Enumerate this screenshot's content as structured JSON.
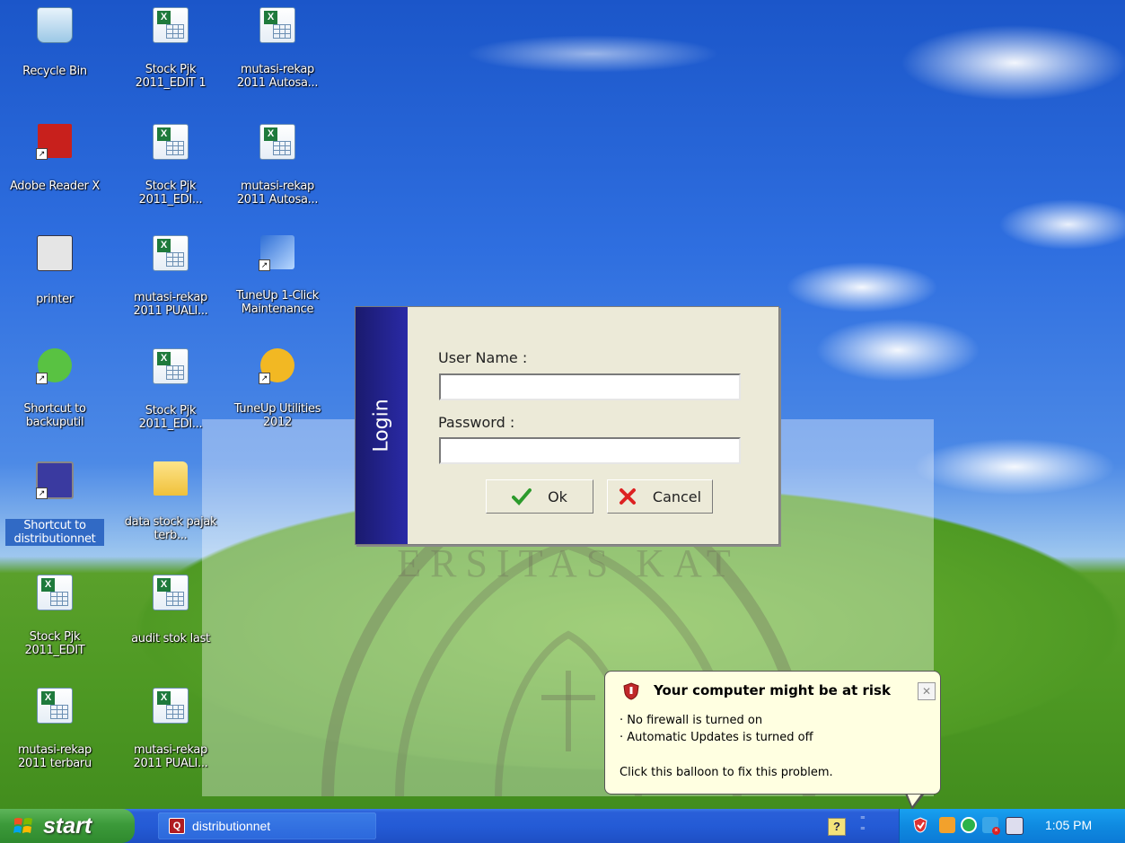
{
  "desktop_icons": [
    {
      "label": "Recycle Bin",
      "icon": "recycle-bin-icon"
    },
    {
      "label": "Stock Pjk 2011_EDIT 1",
      "icon": "excel-file-icon"
    },
    {
      "label": "mutasi-rekap 2011 Autosa...",
      "icon": "excel-file-icon"
    },
    {
      "label": "Adobe Reader X",
      "icon": "adobe-reader-icon"
    },
    {
      "label": "Stock Pjk 2011_EDI...",
      "icon": "excel-file-icon"
    },
    {
      "label": "mutasi-rekap 2011 Autosa...",
      "icon": "excel-file-icon"
    },
    {
      "label": "printer",
      "icon": "printer-app-icon"
    },
    {
      "label": "mutasi-rekap 2011 PUALI...",
      "icon": "excel-file-icon"
    },
    {
      "label": "TuneUp 1-Click Maintenance",
      "icon": "tuneup-maintenance-icon"
    },
    {
      "label": "Shortcut to backuputil",
      "icon": "frog-backup-icon"
    },
    {
      "label": "Stock Pjk 2011_EDI...",
      "icon": "excel-file-icon"
    },
    {
      "label": "TuneUp Utilities 2012",
      "icon": "tuneup-utilities-icon"
    },
    {
      "label": "Shortcut to distributionnet",
      "icon": "distributionnet-icon"
    },
    {
      "label": "data stock pajak terb...",
      "icon": "folder-icon"
    },
    {
      "label": "Stock Pjk 2011_EDIT",
      "icon": "excel-file-icon"
    },
    {
      "label": "audit stok last",
      "icon": "excel-file-icon"
    },
    {
      "label": "mutasi-rekap 2011 terbaru",
      "icon": "excel-file-icon"
    },
    {
      "label": "mutasi-rekap 2011 PUALI...",
      "icon": "excel-file-icon"
    }
  ],
  "login": {
    "side_title": "Login",
    "username_label": "User Name :",
    "username_value": "",
    "password_label": "Password :",
    "password_value": "",
    "ok_label": "Ok",
    "cancel_label": "Cancel"
  },
  "balloon": {
    "title": "Your computer might be at risk",
    "lines": [
      "No firewall is turned on",
      "Automatic Updates is turned off"
    ],
    "footer": "Click this balloon to fix this problem.",
    "close_glyph": "✕"
  },
  "watermark": {
    "text": "ERSITAS KAT"
  },
  "taskbar": {
    "start_label": "start",
    "task_label": "distributionnet",
    "clock": "1:05 PM"
  },
  "colors": {
    "taskbar_blue": "#245bd6",
    "tray_blue": "#0f8ae0",
    "start_green": "#3c9a3a",
    "dialog_side": "#1a1a6e",
    "balloon_bg": "#ffffe1",
    "selection_blue": "#316ac5"
  }
}
